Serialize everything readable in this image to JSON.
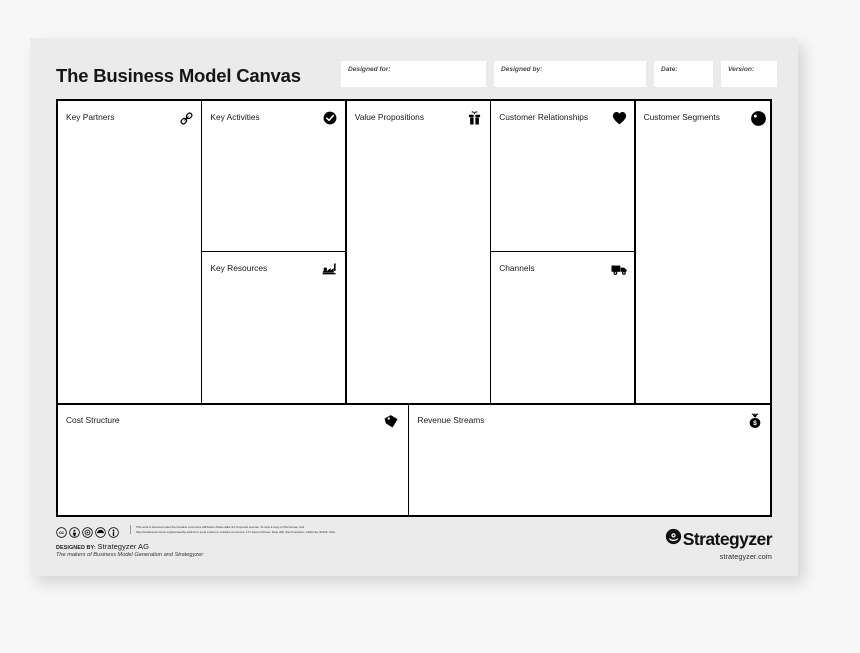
{
  "page": {
    "title": "The Business Model Canvas"
  },
  "header_fields": [
    {
      "id": "designed-for",
      "label": "Designed for:",
      "value": ""
    },
    {
      "id": "designed-by",
      "label": "Designed by:",
      "value": ""
    },
    {
      "id": "date",
      "label": "Date:",
      "value": ""
    },
    {
      "id": "version",
      "label": "Version:",
      "value": ""
    }
  ],
  "blocks": [
    {
      "id": "key-partners",
      "title": "Key Partners",
      "icon": "chain-link-icon"
    },
    {
      "id": "key-activities",
      "title": "Key Activities",
      "icon": "check-circle-icon"
    },
    {
      "id": "key-resources",
      "title": "Key Resources",
      "icon": "factory-icon"
    },
    {
      "id": "value-propositions",
      "title": "Value Propositions",
      "icon": "gift-icon"
    },
    {
      "id": "customer-relationships",
      "title": "Customer Relationships",
      "icon": "heart-icon"
    },
    {
      "id": "channels",
      "title": "Channels",
      "icon": "truck-icon"
    },
    {
      "id": "customer-segments",
      "title": "Customer Segments",
      "icon": "person-head-icon"
    },
    {
      "id": "cost-structure",
      "title": "Cost Structure",
      "icon": "price-tag-icon"
    },
    {
      "id": "revenue-streams",
      "title": "Revenue Streams",
      "icon": "money-bag-icon"
    }
  ],
  "footer": {
    "license_line_1": "This work is licensed under the Creative Commons Attribution-Share Alike 3.0 Unported License. To view a copy of this license, visit",
    "license_line_2": "http://creativecommons.org/licenses/by-sa/3.0/ or send a letter to Creative Commons, 171 Second Street, Suite 300, San Francisco, California, 94105, USA.",
    "designed_by_label": "DESIGNED BY:",
    "designed_by_value": "Strategyzer AG",
    "tagline": "The makers of Business Model Generation and Strategyzer",
    "brand_name": "Strategyzer",
    "brand_url": "strategyzer.com",
    "cc_badges": [
      "cc-icon",
      "cc-by-icon",
      "cc-sa-icon",
      "cc-share-icon",
      "cc-person-icon"
    ]
  },
  "colors": {
    "page_background": "#ebebeb",
    "app_background": "#f7f7f7",
    "grid_line": "#000000",
    "cell_fill": "#ffffff",
    "text": "#1a1a1a"
  }
}
